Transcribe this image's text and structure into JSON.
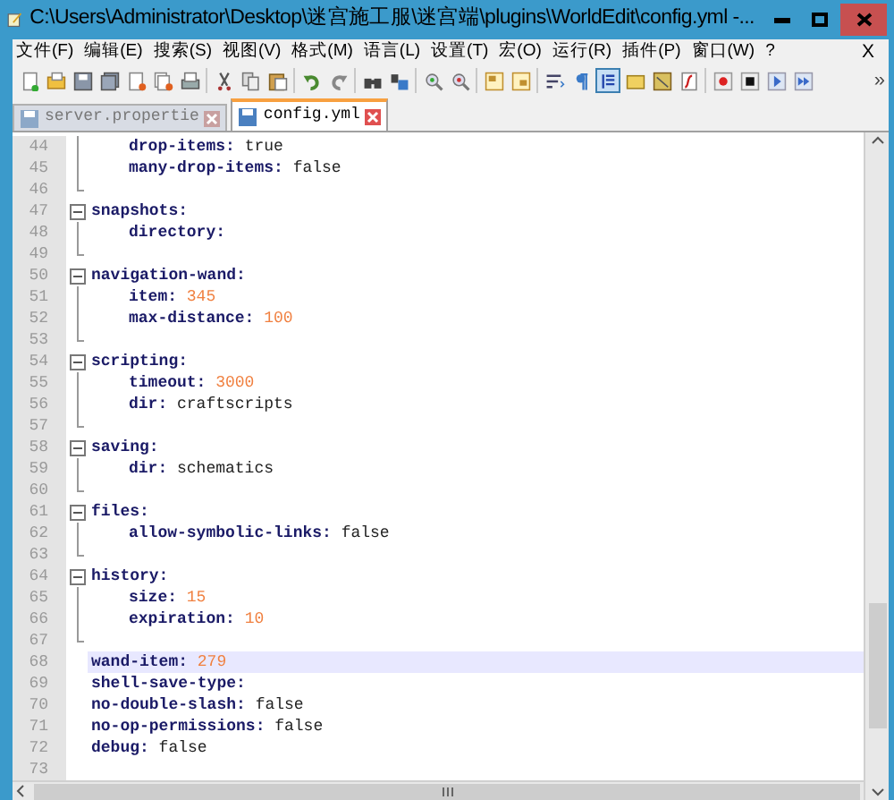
{
  "window": {
    "title": "C:\\Users\\Administrator\\Desktop\\迷宫施工服\\迷宫端\\plugins\\WorldEdit\\config.yml -..."
  },
  "menu": [
    "文件(F)",
    "编辑(E)",
    "搜索(S)",
    "视图(V)",
    "格式(M)",
    "语言(L)",
    "设置(T)",
    "宏(O)",
    "运行(R)",
    "插件(P)",
    "窗口(W)",
    "?"
  ],
  "menu_close": "X",
  "toolbar": [
    {
      "kind": "new",
      "pressed": false
    },
    {
      "kind": "open",
      "pressed": false
    },
    {
      "kind": "save",
      "pressed": false
    },
    {
      "kind": "save-all",
      "pressed": false
    },
    {
      "kind": "close",
      "pressed": false
    },
    {
      "kind": "close-all",
      "pressed": false
    },
    {
      "kind": "print",
      "pressed": false
    },
    {
      "kind": "separator"
    },
    {
      "kind": "cut",
      "pressed": false
    },
    {
      "kind": "copy",
      "pressed": false
    },
    {
      "kind": "paste",
      "pressed": false
    },
    {
      "kind": "separator"
    },
    {
      "kind": "undo",
      "pressed": false
    },
    {
      "kind": "redo",
      "pressed": false
    },
    {
      "kind": "separator"
    },
    {
      "kind": "find",
      "pressed": false
    },
    {
      "kind": "replace",
      "pressed": false
    },
    {
      "kind": "separator"
    },
    {
      "kind": "zoom-in",
      "pressed": false
    },
    {
      "kind": "zoom-out",
      "pressed": false
    },
    {
      "kind": "separator"
    },
    {
      "kind": "sync-v",
      "pressed": false
    },
    {
      "kind": "sync-h",
      "pressed": false
    },
    {
      "kind": "separator"
    },
    {
      "kind": "wrap",
      "pressed": false
    },
    {
      "kind": "all-chars",
      "pressed": false
    },
    {
      "kind": "indent-guide",
      "pressed": true
    },
    {
      "kind": "folder",
      "pressed": false
    },
    {
      "kind": "map",
      "pressed": false
    },
    {
      "kind": "function",
      "pressed": false
    },
    {
      "kind": "separator"
    },
    {
      "kind": "record",
      "pressed": false
    },
    {
      "kind": "stop",
      "pressed": false
    },
    {
      "kind": "play",
      "pressed": false
    },
    {
      "kind": "play-multi",
      "pressed": false
    }
  ],
  "toolbar_more": "»",
  "tabs": [
    {
      "label": "server.propertie",
      "selected": false
    },
    {
      "label": "config.yml",
      "selected": true
    }
  ],
  "lines": [
    {
      "number": "44",
      "kind": "section_body",
      "key": "drop-items:",
      "value": {
        "text": "true",
        "kind": "plain"
      },
      "current": false
    },
    {
      "number": "45",
      "kind": "section_body",
      "key": "many-drop-items:",
      "value": {
        "text": "false",
        "kind": "plain"
      },
      "current": false
    },
    {
      "number": "46",
      "kind": "section_end",
      "current": false
    },
    {
      "number": "47",
      "kind": "section_start",
      "key": "snapshots:",
      "current": false
    },
    {
      "number": "48",
      "kind": "section_body",
      "key": "directory:",
      "current": false
    },
    {
      "number": "49",
      "kind": "section_end",
      "current": false
    },
    {
      "number": "50",
      "kind": "section_start",
      "key": "navigation-wand:",
      "current": false
    },
    {
      "number": "51",
      "kind": "section_body",
      "key": "item:",
      "value": {
        "text": "345",
        "kind": "number"
      },
      "current": false
    },
    {
      "number": "52",
      "kind": "section_body",
      "key": "max-distance:",
      "value": {
        "text": "100",
        "kind": "number"
      },
      "current": false
    },
    {
      "number": "53",
      "kind": "section_end",
      "current": false
    },
    {
      "number": "54",
      "kind": "section_start",
      "key": "scripting:",
      "current": false
    },
    {
      "number": "55",
      "kind": "section_body",
      "key": "timeout:",
      "value": {
        "text": "3000",
        "kind": "number"
      },
      "current": false
    },
    {
      "number": "56",
      "kind": "section_body",
      "key": "dir:",
      "value": {
        "text": "craftscripts",
        "kind": "plain"
      },
      "current": false
    },
    {
      "number": "57",
      "kind": "section_end",
      "current": false
    },
    {
      "number": "58",
      "kind": "section_start",
      "key": "saving:",
      "current": false
    },
    {
      "number": "59",
      "kind": "section_body",
      "key": "dir:",
      "value": {
        "text": "schematics",
        "kind": "plain"
      },
      "current": false
    },
    {
      "number": "60",
      "kind": "section_end",
      "current": false
    },
    {
      "number": "61",
      "kind": "section_start",
      "key": "files:",
      "current": false
    },
    {
      "number": "62",
      "kind": "section_body",
      "key": "allow-symbolic-links:",
      "value": {
        "text": "false",
        "kind": "plain"
      },
      "current": false
    },
    {
      "number": "63",
      "kind": "section_end",
      "current": false
    },
    {
      "number": "64",
      "kind": "section_start",
      "key": "history:",
      "current": false
    },
    {
      "number": "65",
      "kind": "section_body",
      "key": "size:",
      "value": {
        "text": "15",
        "kind": "number"
      },
      "current": false
    },
    {
      "number": "66",
      "kind": "section_body",
      "key": "expiration:",
      "value": {
        "text": "10",
        "kind": "number"
      },
      "current": false
    },
    {
      "number": "67",
      "kind": "section_end",
      "current": false
    },
    {
      "number": "68",
      "kind": "plain",
      "key": "wand-item:",
      "value": {
        "text": "279",
        "kind": "number"
      },
      "current": true
    },
    {
      "number": "69",
      "kind": "plain",
      "key": "shell-save-type:",
      "current": false
    },
    {
      "number": "70",
      "kind": "plain",
      "key": "no-double-slash:",
      "value": {
        "text": "false",
        "kind": "plain"
      },
      "current": false
    },
    {
      "number": "71",
      "kind": "plain",
      "key": "no-op-permissions:",
      "value": {
        "text": "false",
        "kind": "plain"
      },
      "current": false
    },
    {
      "number": "72",
      "kind": "plain",
      "key": "debug:",
      "value": {
        "text": "false",
        "kind": "plain"
      },
      "current": false
    },
    {
      "number": "73",
      "kind": "plain",
      "current": false
    }
  ]
}
